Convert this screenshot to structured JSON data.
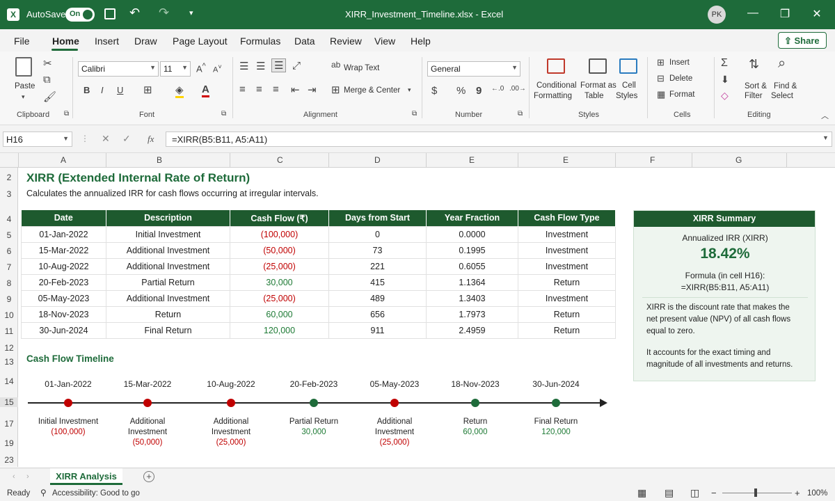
{
  "titlebar": {
    "autosave_label": "AutoSave",
    "autosave_state": "On",
    "file_title": "XIRR_Investment_Timeline.xlsx",
    "app_name": "Excel",
    "separator": "-",
    "user_initials": "PK"
  },
  "menu": {
    "items": [
      "File",
      "Home",
      "Insert",
      "Draw",
      "Page Layout",
      "Formulas",
      "Data",
      "Review",
      "View",
      "Help"
    ],
    "active": "Home",
    "share_label": "Share"
  },
  "ribbon": {
    "clipboard": {
      "paste": "Paste",
      "label": "Clipboard"
    },
    "font": {
      "name": "Calibri",
      "size": "11",
      "label": "Font",
      "bold": "B",
      "italic": "I",
      "underline": "U"
    },
    "alignment": {
      "wrap": "Wrap Text",
      "merge": "Merge & Center",
      "label": "Alignment"
    },
    "number": {
      "format": "General",
      "currency": "$",
      "percent": "%",
      "comma": "9",
      "label": "Number"
    },
    "styles": {
      "conditional": "Conditional",
      "conditional2": "Formatting",
      "format_as": "Format as",
      "format_as2": "Table",
      "cell": "Cell",
      "cell2": "Styles",
      "label": "Styles"
    },
    "cells": {
      "insert": "Insert",
      "delete": "Delete",
      "format": "Format",
      "label": "Cells"
    },
    "editing": {
      "sort": "Sort &",
      "sort2": "Filter",
      "find": "Find &",
      "find2": "Select",
      "label": "Editing"
    }
  },
  "formula_bar": {
    "name_box": "H16",
    "fx": "fx",
    "formula": "=XIRR(B5:B11, A5:A11)"
  },
  "columns": [
    "A",
    "B",
    "C",
    "D",
    "E",
    "E",
    "F",
    "G"
  ],
  "rows": [
    "2",
    "3",
    "4",
    "5",
    "6",
    "7",
    "8",
    "9",
    "10",
    "11",
    "12",
    "13",
    "14",
    "15",
    "17",
    "19",
    "23"
  ],
  "sheet": {
    "title": "XIRR (Extended Internal Rate of Return)",
    "subtitle": "Calculates the annualized IRR for cash flows occurring at irregular intervals."
  },
  "table": {
    "headers": [
      "Date",
      "Description",
      "Cash Flow (₹)",
      "Days from Start",
      "Year Fraction",
      "Cash Flow Type"
    ],
    "rows": [
      [
        "01-Jan-2022",
        "Initial Investment",
        "(100,000)",
        "0",
        "0.0000",
        "Investment"
      ],
      [
        "15-Mar-2022",
        "Additional Investment",
        "(50,000)",
        "73",
        "0.1995",
        "Investment"
      ],
      [
        "10-Aug-2022",
        "Additional Investment",
        "(25,000)",
        "221",
        "0.6055",
        "Investment"
      ],
      [
        "20-Feb-2023",
        "Partial Return",
        "30,000",
        "415",
        "1.1364",
        "Return"
      ],
      [
        "05-May-2023",
        "Additional Investment",
        "(25,000)",
        "489",
        "1.3403",
        "Investment"
      ],
      [
        "18-Nov-2023",
        "Return",
        "60,000",
        "656",
        "1.7973",
        "Return"
      ],
      [
        "30-Jun-2024",
        "Final Return",
        "120,000",
        "911",
        "2.4959",
        "Return"
      ]
    ]
  },
  "summary": {
    "title": "XIRR Summary",
    "irr_label": "Annualized IRR (XIRR)",
    "irr_value": "18.42%",
    "formula_label": "Formula (in cell H16):",
    "formula": "=XIRR(B5:B11, A5:A11)",
    "note1_line1": "XIRR is the discount rate that makes the",
    "note1_line2": "net present value (NPV) of all cash flows",
    "note1_line3": "equal to zero.",
    "note2_line1": "It accounts for the exact timing and",
    "note2_line2": "magnitude of all investments and returns."
  },
  "timeline": {
    "title": "Cash Flow Timeline",
    "events": [
      {
        "date": "01-Jan-2022",
        "label": "Initial Investment",
        "label2": "",
        "amount": "(100,000)",
        "kind": "investment"
      },
      {
        "date": "15-Mar-2022",
        "label": "Additional",
        "label2": "Investment",
        "amount": "(50,000)",
        "kind": "investment"
      },
      {
        "date": "10-Aug-2022",
        "label": "Additional",
        "label2": "Investment",
        "amount": "(25,000)",
        "kind": "investment"
      },
      {
        "date": "20-Feb-2023",
        "label": "Partial Return",
        "label2": "",
        "amount": "30,000",
        "kind": "return"
      },
      {
        "date": "05-May-2023",
        "label": "Additional",
        "label2": "Investment",
        "amount": "(25,000)",
        "kind": "investment"
      },
      {
        "date": "18-Nov-2023",
        "label": "Return",
        "label2": "",
        "amount": "60,000",
        "kind": "return"
      },
      {
        "date": "30-Jun-2024",
        "label": "Final Return",
        "label2": "",
        "amount": "120,000",
        "kind": "return"
      }
    ]
  },
  "tabs": {
    "sheet_tab": "XIRR Analysis",
    "add": "+"
  },
  "status": {
    "ready": "Ready",
    "accessibility": "Accessibility: Good to go",
    "zoom": "100%",
    "minus": "−",
    "plus": "+"
  },
  "colors": {
    "brand_green": "#1e6b3a",
    "header_green": "#1e5a2e",
    "negative": "#c00000",
    "positive": "#1e7a35"
  },
  "icons": [
    "excel-logo-icon",
    "save-icon",
    "undo-icon",
    "redo-icon",
    "paste-icon",
    "cut-icon",
    "copy-icon",
    "format-painter-icon",
    "sort-filter-icon",
    "find-icon"
  ]
}
